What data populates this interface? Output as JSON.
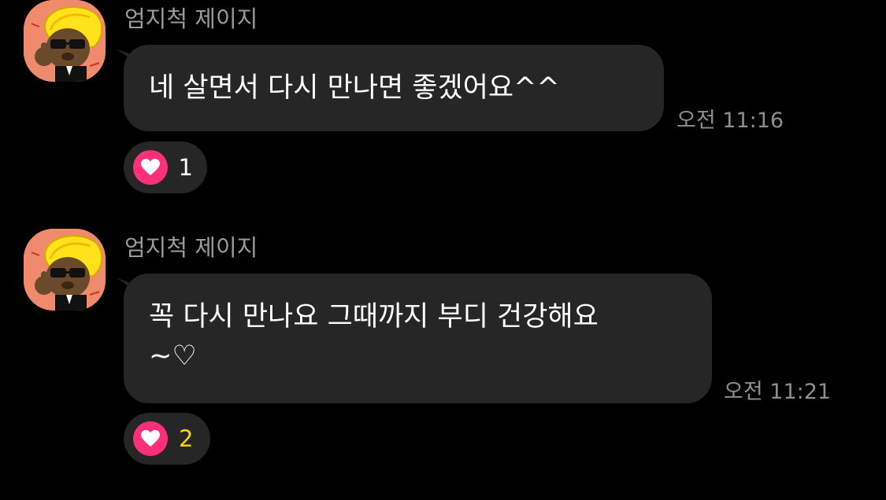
{
  "messages": [
    {
      "sender": "엄지척 제이지",
      "text_lines": [
        "네 살면서 다시 만나면 좋겠어요^^"
      ],
      "time": "오전 11:16",
      "reaction": {
        "icon": "heart-icon",
        "count": "1",
        "count_color": "#ffffff"
      }
    },
    {
      "sender": "엄지척 제이지",
      "text_lines": [
        "꼭 다시 만나요 그때까지 부디 건강해요",
        "~♡"
      ],
      "time": "오전 11:21",
      "reaction": {
        "icon": "heart-icon",
        "count": "2",
        "count_color": "#ffd400"
      }
    }
  ],
  "colors": {
    "background": "#000000",
    "bubble": "#262626",
    "heart": "#ff2f7a",
    "avatar_bg": "#f08a6c"
  }
}
